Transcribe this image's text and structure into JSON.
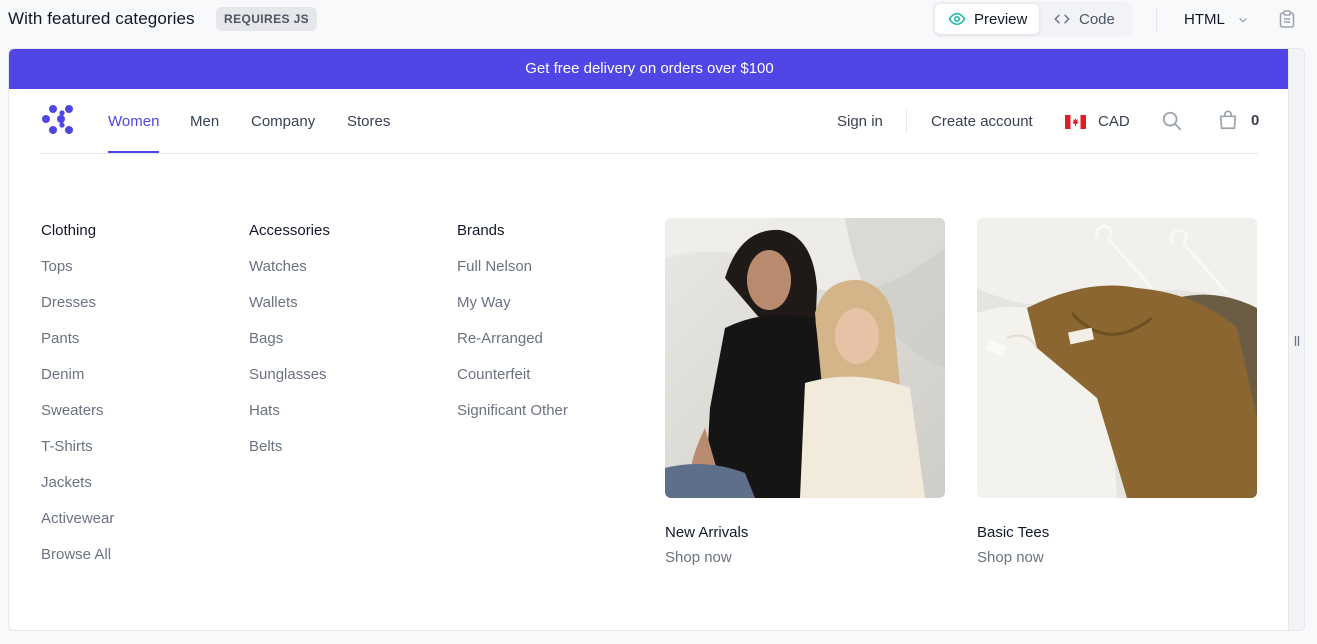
{
  "doc": {
    "title": "With featured categories",
    "badge": "REQUIRES JS",
    "preview_label": "Preview",
    "code_label": "Code",
    "language": "HTML"
  },
  "promo": {
    "text": "Get free delivery on orders over $100"
  },
  "nav": {
    "items": [
      {
        "label": "Women",
        "active": true
      },
      {
        "label": "Men"
      },
      {
        "label": "Company"
      },
      {
        "label": "Stores"
      }
    ],
    "sign_in": "Sign in",
    "create_account": "Create account",
    "currency": "CAD",
    "cart_count": "0"
  },
  "menu": {
    "columns": [
      {
        "heading": "Clothing",
        "items": [
          "Tops",
          "Dresses",
          "Pants",
          "Denim",
          "Sweaters",
          "T-Shirts",
          "Jackets",
          "Activewear",
          "Browse All"
        ]
      },
      {
        "heading": "Accessories",
        "items": [
          "Watches",
          "Wallets",
          "Bags",
          "Sunglasses",
          "Hats",
          "Belts"
        ]
      },
      {
        "heading": "Brands",
        "items": [
          "Full Nelson",
          "My Way",
          "Re-Arranged",
          "Counterfeit",
          "Significant Other"
        ]
      }
    ],
    "featured": [
      {
        "title": "New Arrivals",
        "cta": "Shop now"
      },
      {
        "title": "Basic Tees",
        "cta": "Shop now"
      }
    ]
  },
  "colors": {
    "accent": "#4f46e5",
    "page_bg": "#f8f9fb",
    "muted_text": "#6b7280"
  },
  "icons": {
    "logo": "brand-mark-icon",
    "preview": "eye-icon",
    "code": "code-brackets-icon",
    "dropdown": "chevron-down-icon",
    "copy": "clipboard-icon",
    "flag": "canada-flag-icon",
    "search": "search-icon",
    "cart": "shopping-bag-icon",
    "resize": "resize-handle-icon"
  }
}
